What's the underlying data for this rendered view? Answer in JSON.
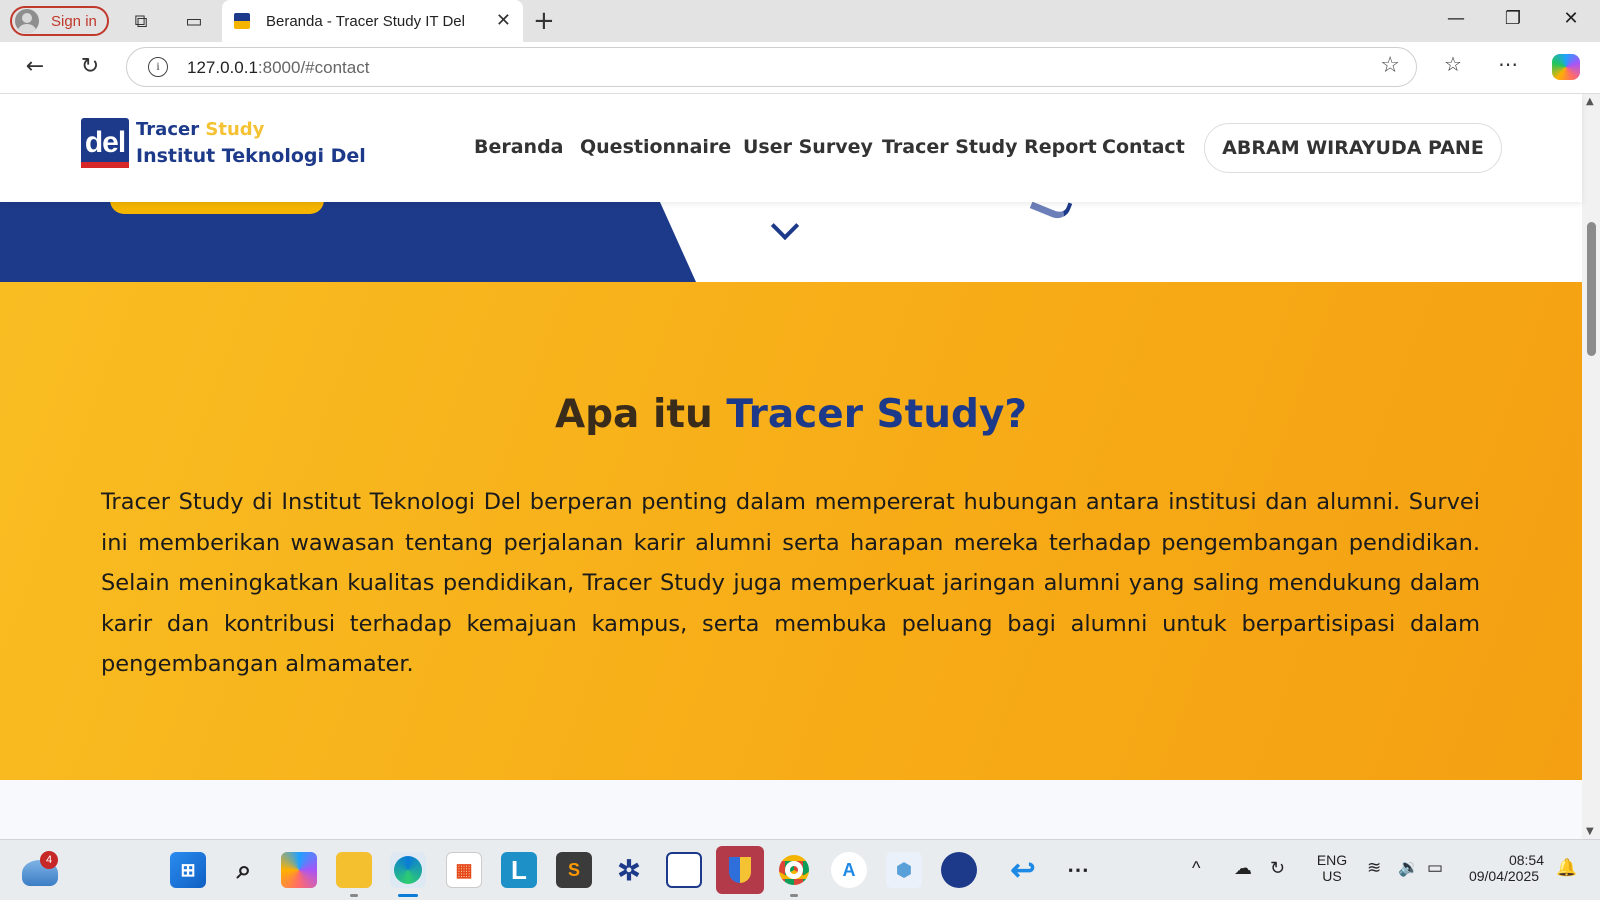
{
  "browser": {
    "signin_label": "Sign in",
    "tab_title": "Beranda - Tracer Study IT Del",
    "url_host": "127.0.0.1",
    "url_rest": ":8000/#contact"
  },
  "site": {
    "brand_line1_a": "Tracer",
    "brand_line1_b": "Study",
    "brand_line2": "Institut Teknologi Del",
    "logo_text": "del",
    "nav": [
      "Beranda",
      "Questionnaire",
      "User Survey",
      "Tracer Study Report",
      "Contact"
    ],
    "user_name": "ABRAM WIRAYUDA PANE"
  },
  "section": {
    "title_a": "Apa itu",
    "title_b": "Tracer Study?",
    "body": "Tracer Study di Institut Teknologi Del berperan penting dalam mempererat hubungan antara institusi dan alumni. Survei ini memberikan wawasan tentang perjalanan karir alumni serta harapan mereka terhadap pengembangan pendidikan. Selain meningkatkan kualitas pendidikan, Tracer Study juga memperkuat jaringan alumni yang saling mendukung dalam karir dan kontribusi terhadap kemajuan kampus, serta membuka peluang bagi alumni untuk berpartisipasi dalam pengembangan almamater."
  },
  "taskbar": {
    "weather_badge": "4",
    "lang_line1": "ENG",
    "lang_line2": "US",
    "time": "08:54",
    "date": "09/04/2025"
  },
  "colors": {
    "brand_blue": "#1d3a8a",
    "brand_yellow": "#f4c233",
    "section_yellow": "#f9bd22"
  }
}
